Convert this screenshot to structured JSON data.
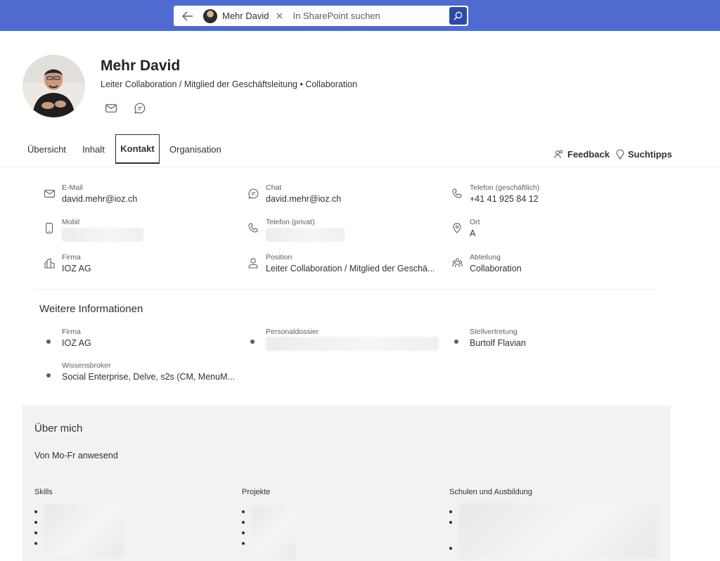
{
  "search": {
    "chip_label": "Mehr David",
    "placeholder": "In SharePoint suchen"
  },
  "profile": {
    "name": "Mehr David",
    "subtitle": "Leiter Collaboration / Mitglied der Geschäftsleitung • Collaboration"
  },
  "tabs": {
    "overview": "Übersicht",
    "content": "Inhalt",
    "contact": "Kontakt",
    "organisation": "Organisation"
  },
  "links": {
    "feedback": "Feedback",
    "tips": "Suchtipps"
  },
  "contact": {
    "email_label": "E-Mail",
    "email_value": "david.mehr@ioz.ch",
    "chat_label": "Chat",
    "chat_value": "david.mehr@ioz.ch",
    "phone_business_label": "Telefon (geschäftlich)",
    "phone_business_value": "+41 41 925 84 12",
    "mobile_label": "Mobil",
    "phone_private_label": "Telefon (privat)",
    "location_label": "Ort",
    "location_value": "A",
    "company_label": "Firma",
    "company_value": "IOZ AG",
    "position_label": "Position",
    "position_value": "Leiter Collaboration / Mitglied der Geschä...",
    "department_label": "Abteilung",
    "department_value": "Collaboration"
  },
  "more_info": {
    "title": "Weitere Informationen",
    "company_label": "Firma",
    "company_value": "IOZ AG",
    "dossier_label": "Personaldossier",
    "deputy_label": "Stellvertretung",
    "deputy_value": "Burtolf Flavian",
    "broker_label": "Wissensbroker",
    "broker_value": "Social Enterprise, Delve, s2s (CM, MenuM..."
  },
  "about": {
    "title": "Über mich",
    "text": "Von Mo-Fr anwesend",
    "skills_label": "Skills",
    "projects_label": "Projekte",
    "education_label": "Schulen und Ausbildung"
  },
  "colors": {
    "topbar": "#4f6bcf",
    "search_button": "#2c4aa8",
    "about_bg": "#f3f2f1"
  }
}
